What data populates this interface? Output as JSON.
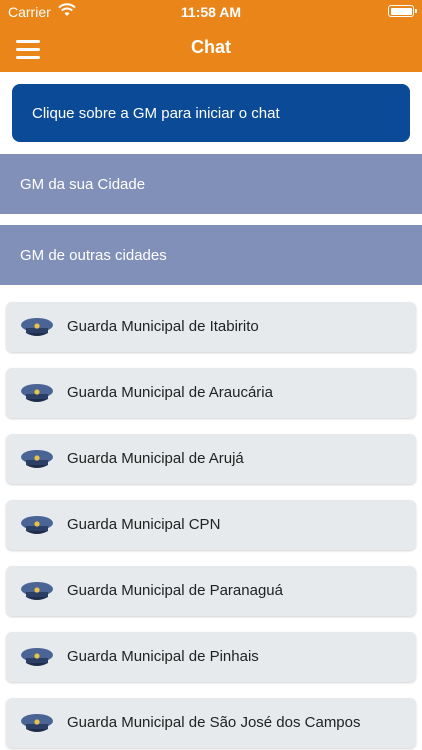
{
  "status_bar": {
    "carrier": "Carrier",
    "time": "11:58 AM"
  },
  "nav": {
    "title": "Chat",
    "menu_icon": "hamburger-menu-icon"
  },
  "banner": {
    "text": "Clique sobre a GM para iniciar o chat"
  },
  "sections": [
    {
      "label": "GM da sua Cidade"
    },
    {
      "label": "GM de outras cidades"
    }
  ],
  "items": [
    {
      "label": "Guarda Municipal de Itabirito",
      "icon": "police-cap-icon"
    },
    {
      "label": "Guarda Municipal de Araucária",
      "icon": "police-cap-icon"
    },
    {
      "label": "Guarda Municipal de Arujá",
      "icon": "police-cap-icon"
    },
    {
      "label": "Guarda Municipal CPN",
      "icon": "police-cap-icon"
    },
    {
      "label": "Guarda Municipal de Paranaguá",
      "icon": "police-cap-icon"
    },
    {
      "label": "Guarda Municipal de Pinhais",
      "icon": "police-cap-icon"
    },
    {
      "label": "Guarda Municipal de São José dos Campos",
      "icon": "police-cap-icon"
    }
  ],
  "colors": {
    "header": "#ea8519",
    "banner": "#0b4a97",
    "section": "#8190b8",
    "item": "#e6eaec",
    "cap": "#3e5a8c"
  }
}
